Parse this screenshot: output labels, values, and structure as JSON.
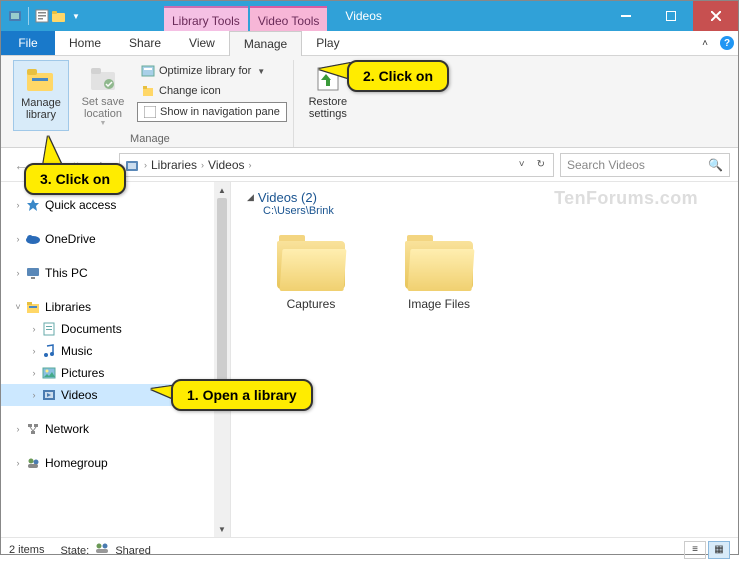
{
  "title": "Videos",
  "tool_tabs": {
    "t1": "Library Tools",
    "t2": "Video Tools"
  },
  "menu": {
    "file": "File",
    "home": "Home",
    "share": "Share",
    "view": "View",
    "manage": "Manage",
    "play": "Play"
  },
  "ribbon": {
    "manage_library": "Manage\nlibrary",
    "set_save": "Set save\nlocation",
    "optimize": "Optimize library for",
    "change_icon": "Change icon",
    "show_nav": "Show in navigation pane",
    "group_manage": "Manage",
    "restore": "Restore\nsettings"
  },
  "address": {
    "libs": "Libraries",
    "videos": "Videos"
  },
  "search_placeholder": "Search Videos",
  "tree": {
    "quick": "Quick access",
    "onedrive": "OneDrive",
    "thispc": "This PC",
    "libraries": "Libraries",
    "documents": "Documents",
    "music": "Music",
    "pictures": "Pictures",
    "videos": "Videos",
    "network": "Network",
    "homegroup": "Homegroup"
  },
  "content": {
    "header": "Videos (2)",
    "sub": "C:\\Users\\Brink",
    "folders": [
      "Captures",
      "Image Files"
    ]
  },
  "status": {
    "items": "2 items",
    "state_lbl": "State:",
    "state_val": "Shared"
  },
  "callouts": {
    "c1": "1. Open a library",
    "c2": "2. Click on",
    "c3": "3. Click on"
  },
  "watermark": "TenForums.com"
}
